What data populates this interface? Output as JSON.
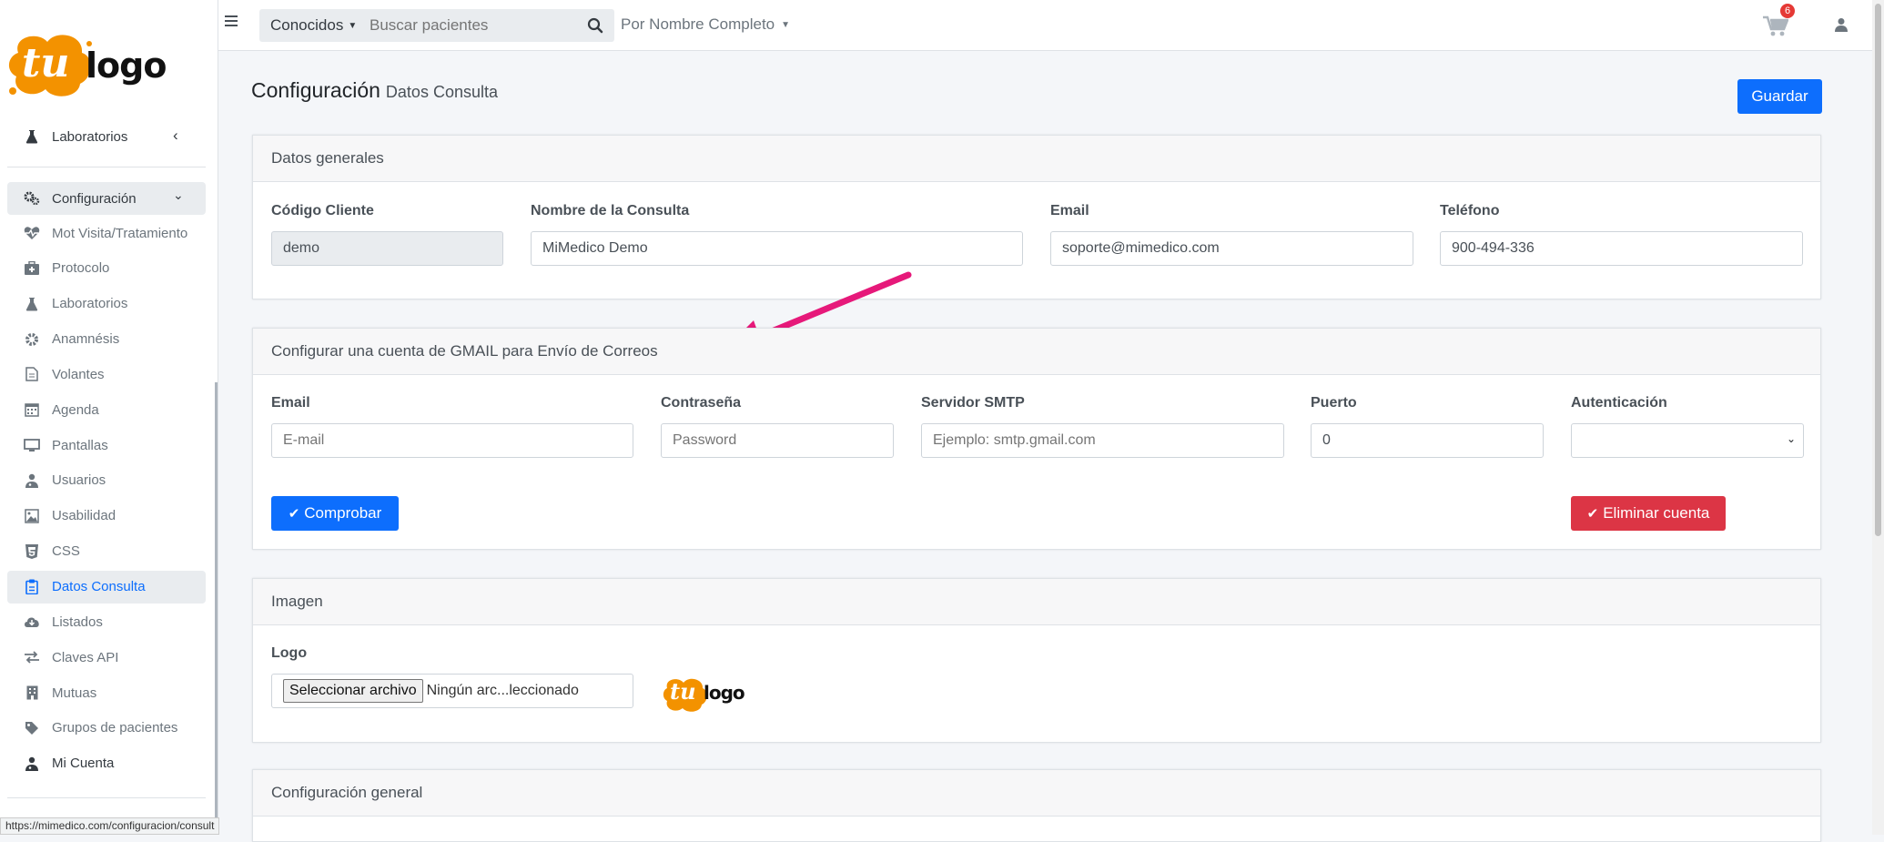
{
  "colors": {
    "primary": "#0d6efd",
    "danger": "#dc3545",
    "logo_orange": "#f39200",
    "arrow": "#e6197a",
    "badge": "#e53935"
  },
  "logo": {
    "text_tu": "tu",
    "text_logo": "logo"
  },
  "sidebar": {
    "top_item": {
      "label": "Laboratorios",
      "icon": "flask-icon"
    },
    "section": {
      "label": "Configuración",
      "icon": "gears-icon"
    },
    "items": [
      {
        "label": "Mot Visita/Tratamiento",
        "icon": "heartbeat-icon"
      },
      {
        "label": "Protocolo",
        "icon": "medkit-icon"
      },
      {
        "label": "Laboratorios",
        "icon": "flask-icon"
      },
      {
        "label": "Anamnésis",
        "icon": "gear-icon"
      },
      {
        "label": "Volantes",
        "icon": "document-icon"
      },
      {
        "label": "Agenda",
        "icon": "calendar-icon"
      },
      {
        "label": "Pantallas",
        "icon": "monitor-icon"
      },
      {
        "label": "Usuarios",
        "icon": "user-md-icon"
      },
      {
        "label": "Usabilidad",
        "icon": "image-icon"
      },
      {
        "label": "CSS",
        "icon": "css3-icon"
      },
      {
        "label": "Datos Consulta",
        "icon": "clipboard-icon",
        "active": true
      },
      {
        "label": "Listados",
        "icon": "cloud-download-icon"
      },
      {
        "label": "Claves API",
        "icon": "exchange-icon"
      },
      {
        "label": "Mutuas",
        "icon": "building-icon"
      },
      {
        "label": "Grupos de pacientes",
        "icon": "tag-icon"
      },
      {
        "label": "Mi Cuenta",
        "icon": "user-icon"
      }
    ]
  },
  "statusbar": {
    "url": "https://mimedico.com/configuracion/consult"
  },
  "topbar": {
    "filter_label": "Conocidos",
    "search_placeholder": "Buscar pacientes",
    "sort_label": "Por Nombre Completo",
    "cart_count": "6"
  },
  "page": {
    "title": "Configuración",
    "subtitle": "Datos Consulta",
    "save_label": "Guardar"
  },
  "general": {
    "header": "Datos generales",
    "client_code_label": "Código Cliente",
    "client_code_value": "demo",
    "name_label": "Nombre de la Consulta",
    "name_value": "MiMedico Demo",
    "email_label": "Email",
    "email_value": "soporte@mimedico.com",
    "phone_label": "Teléfono",
    "phone_value": "900-494-336"
  },
  "gmail": {
    "header": "Configurar una cuenta de GMAIL para Envío de Correos",
    "email_label": "Email",
    "email_placeholder": "E-mail",
    "password_label": "Contraseña",
    "password_placeholder": "Password",
    "smtp_label": "Servidor SMTP",
    "smtp_placeholder": "Ejemplo: smtp.gmail.com",
    "port_label": "Puerto",
    "port_value": "0",
    "auth_label": "Autenticación",
    "auth_value": "",
    "check_label": "Comprobar",
    "delete_label": "Eliminar cuenta"
  },
  "image": {
    "header": "Imagen",
    "logo_label": "Logo",
    "file_button": "Seleccionar archivo",
    "file_status": "Ningún arc...leccionado"
  },
  "config_general": {
    "header": "Configuración general"
  }
}
